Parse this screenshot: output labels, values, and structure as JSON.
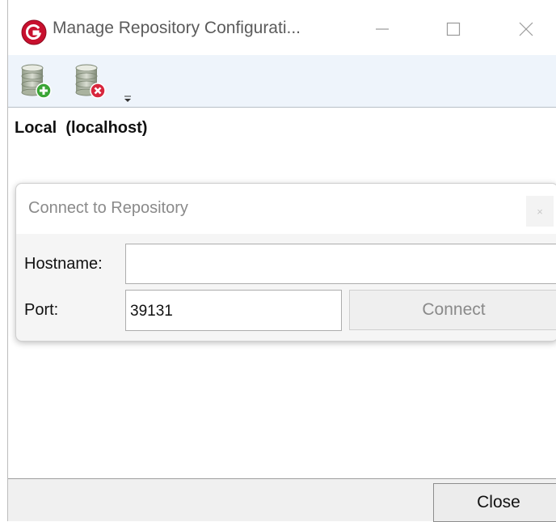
{
  "window": {
    "title": "Manage Repository Configurati..."
  },
  "toolbar": {
    "icons": [
      "database-add-icon",
      "database-remove-icon",
      "overflow-dropdown-icon"
    ]
  },
  "repositories": [
    {
      "label": "Local  (localhost)"
    }
  ],
  "connect_popup": {
    "title": "Connect to Repository",
    "close_glyph": "×",
    "hostname_label": "Hostname:",
    "hostname_value": "",
    "port_label": "Port:",
    "port_value": "39131",
    "connect_label": "Connect"
  },
  "footer": {
    "close_label": "Close"
  },
  "colors": {
    "toolbar_bg": "#eef4fb",
    "app_icon_red": "#c8102e",
    "add_green": "#3aa536",
    "remove_red": "#d7263d"
  }
}
